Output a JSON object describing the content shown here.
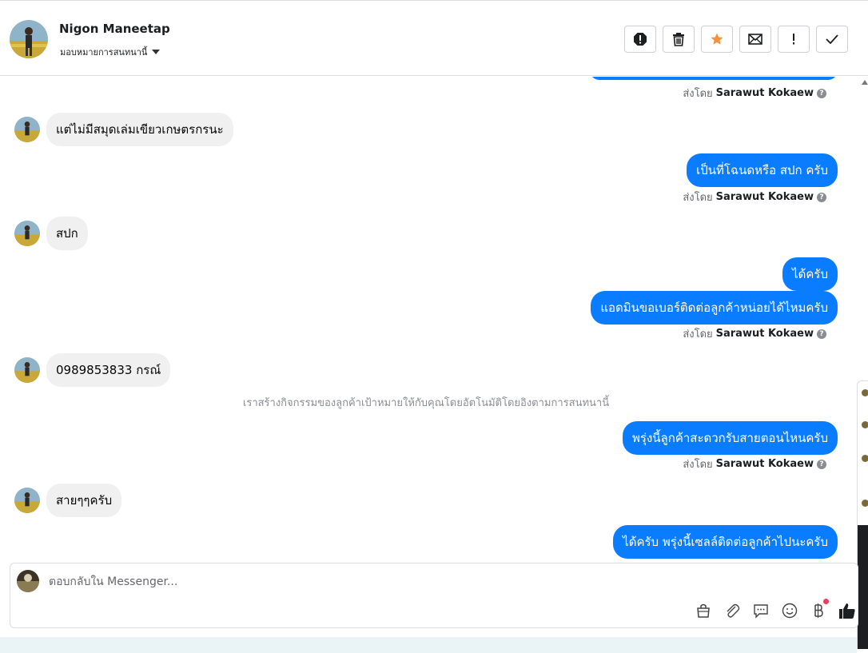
{
  "header": {
    "contact_name": "Nigon Maneetap",
    "assign_label": "มอบหมายการสนทนานี้",
    "actions": [
      {
        "name": "spam-icon",
        "label": "spam"
      },
      {
        "name": "trash-icon",
        "label": "delete"
      },
      {
        "name": "star-icon",
        "label": "star",
        "color": "#f5933d"
      },
      {
        "name": "mail-icon",
        "label": "mark unread"
      },
      {
        "name": "exclamation-icon",
        "label": "follow up"
      },
      {
        "name": "check-icon",
        "label": "done"
      }
    ]
  },
  "colors": {
    "outgoing_bubble": "#0a7cff",
    "incoming_bubble": "#f0f0f0"
  },
  "sent_by_prefix": "ส่งโดย",
  "agent_name": "Sarawut Kokaew",
  "messages": {
    "in_1": "แต่ไม่มีสมุดเล่มเขียวเกษตรกรนะ",
    "out_1": "เป็นที่โฉนดหรือ สปก ครับ",
    "in_2": "สปก",
    "out_2": "ได้ครับ",
    "out_3": "แอดมินขอเบอร์ติดต่อลูกค้าหน่อยได้ไหมครับ",
    "in_3": "0989853833  กรณ์",
    "system_note": "เราสร้างกิจกรรมของลูกค้าเป้าหมายให้กับคุณโดยอัตโนมัติโดยอิงตามการสนทนานี้",
    "out_4": "พรุ่งนี้ลูกค้าสะดวกรับสายตอนไหนครับ",
    "in_4": "สายๆๆครับ",
    "out_5": "ได้ครับ พรุ่งนี้เซลล์ติดต่อลูกค้าไปนะครับ"
  },
  "composer": {
    "placeholder": "ตอบกลับใน Messenger...",
    "tools": [
      "shopping-bag-icon",
      "paperclip-icon",
      "saved-reply-icon",
      "emoji-icon",
      "baht-icon",
      "thumbs-up-icon"
    ]
  }
}
